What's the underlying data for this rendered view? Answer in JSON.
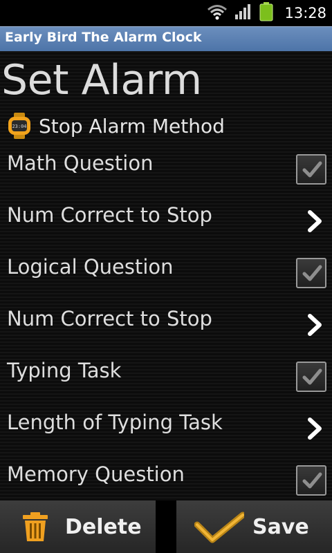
{
  "status_bar": {
    "time": "13:28",
    "icons": [
      "wifi-icon",
      "signal-icon",
      "battery-icon"
    ]
  },
  "app": {
    "title": "Early Bird The Alarm Clock"
  },
  "screen": {
    "title": "Set Alarm",
    "section": {
      "label": "Stop Alarm Method",
      "icon": "watch-icon"
    },
    "rows": [
      {
        "label": "Math Question",
        "control": "checkbox",
        "checked": true
      },
      {
        "label": "Num Correct to Stop",
        "control": "chevron"
      },
      {
        "label": "Logical Question",
        "control": "checkbox",
        "checked": true
      },
      {
        "label": "Num Correct to Stop",
        "control": "chevron"
      },
      {
        "label": "Typing Task",
        "control": "checkbox",
        "checked": true
      },
      {
        "label": "Length of Typing Task",
        "control": "chevron"
      },
      {
        "label": "Memory Question",
        "control": "checkbox",
        "checked": true
      }
    ]
  },
  "actions": {
    "delete_label": "Delete",
    "save_label": "Save"
  },
  "colors": {
    "title_bar": "#5a80b2",
    "accent_orange": "#f0a020",
    "checkmark": "#8a8a8a"
  }
}
